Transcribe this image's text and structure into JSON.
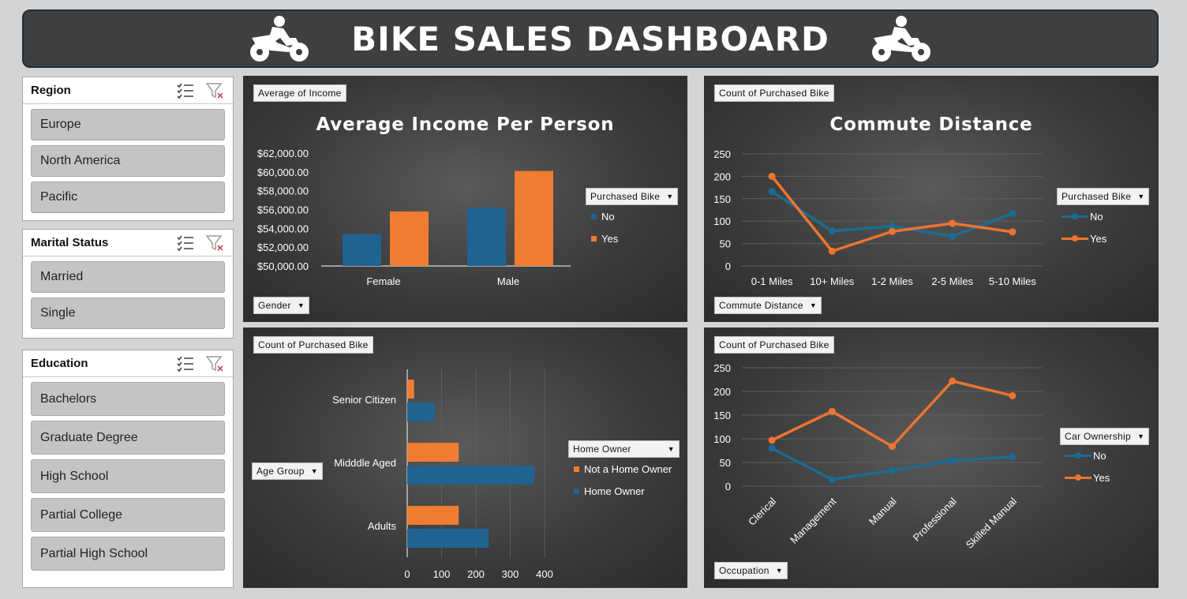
{
  "header": {
    "title": "BIKE SALES DASHBOARD"
  },
  "colors": {
    "no": "#1f6391",
    "yes": "#f07c30",
    "line_no": "#1d6b93",
    "line_yes": "#ee7430"
  },
  "icons": {
    "left": "motorbike-icon",
    "right": "motorbike-icon",
    "multi_select": "multi-select-icon",
    "clear_filter": "clear-filter-icon"
  },
  "slicers": {
    "region": {
      "title": "Region",
      "items": [
        "Europe",
        "North America",
        "Pacific"
      ]
    },
    "marital": {
      "title": "Marital Status",
      "items": [
        "Married",
        "Single"
      ]
    },
    "education": {
      "title": "Education",
      "items": [
        "Bachelors",
        "Graduate Degree",
        "High School",
        "Partial College",
        "Partial High School"
      ]
    }
  },
  "income_panel": {
    "value_field": "Average of Income",
    "axis_field": "Gender",
    "legend_field": "Purchased Bike"
  },
  "commute_panel": {
    "value_field": "Count of Purchased Bike",
    "axis_field": "Commute Distance",
    "legend_field": "Purchased Bike"
  },
  "age_panel": {
    "value_field": "Count of Purchased Bike",
    "axis_field": "Age Group",
    "legend_field": "Home Owner"
  },
  "occupation_panel": {
    "value_field": "Count of Purchased Bike",
    "axis_field": "Occupation",
    "legend_field": "Car Ownership"
  },
  "chart_data": [
    {
      "type": "bar",
      "title": "Average Income Per Person",
      "categories": [
        "Female",
        "Male"
      ],
      "series": [
        {
          "name": "No",
          "values": [
            53400,
            56200
          ]
        },
        {
          "name": "Yes",
          "values": [
            55800,
            60100
          ]
        }
      ],
      "ylim": [
        50000,
        62000
      ],
      "yticks": [
        "$50,000.00",
        "$52,000.00",
        "$54,000.00",
        "$56,000.00",
        "$58,000.00",
        "$60,000.00",
        "$62,000.00"
      ],
      "grid": false,
      "legend": "right"
    },
    {
      "type": "line",
      "title": "Commute Distance",
      "categories": [
        "0-1 Miles",
        "10+ Miles",
        "1-2 Miles",
        "2-5 Miles",
        "5-10 Miles"
      ],
      "series": [
        {
          "name": "No",
          "values": [
            166,
            78,
            89,
            66,
            117
          ]
        },
        {
          "name": "Yes",
          "values": [
            200,
            33,
            77,
            95,
            76
          ]
        }
      ],
      "ylim": [
        0,
        250
      ],
      "yticks": [
        "0",
        "50",
        "100",
        "150",
        "200",
        "250"
      ],
      "grid": true,
      "legend": "right"
    },
    {
      "type": "bar",
      "orientation": "horizontal",
      "categories": [
        "Senior Citizen",
        "Midddle Aged",
        "Adults"
      ],
      "series": [
        {
          "name": "Not a Home Owner",
          "values": [
            20,
            150,
            150
          ]
        },
        {
          "name": "Home Owner",
          "values": [
            80,
            370,
            237
          ]
        }
      ],
      "xlim": [
        0,
        400
      ],
      "xticks": [
        "0",
        "100",
        "200",
        "300",
        "400"
      ],
      "grid": true,
      "legend": "right"
    },
    {
      "type": "line",
      "categories": [
        "Clerical",
        "Management",
        "Manual",
        "Professional",
        "Skilled Manual"
      ],
      "series": [
        {
          "name": "No",
          "values": [
            80,
            14,
            33,
            54,
            62
          ]
        },
        {
          "name": "Yes",
          "values": [
            97,
            158,
            84,
            222,
            191
          ]
        }
      ],
      "ylim": [
        0,
        250
      ],
      "yticks": [
        "0",
        "50",
        "100",
        "150",
        "200",
        "250"
      ],
      "grid": true,
      "legend": "right"
    }
  ]
}
